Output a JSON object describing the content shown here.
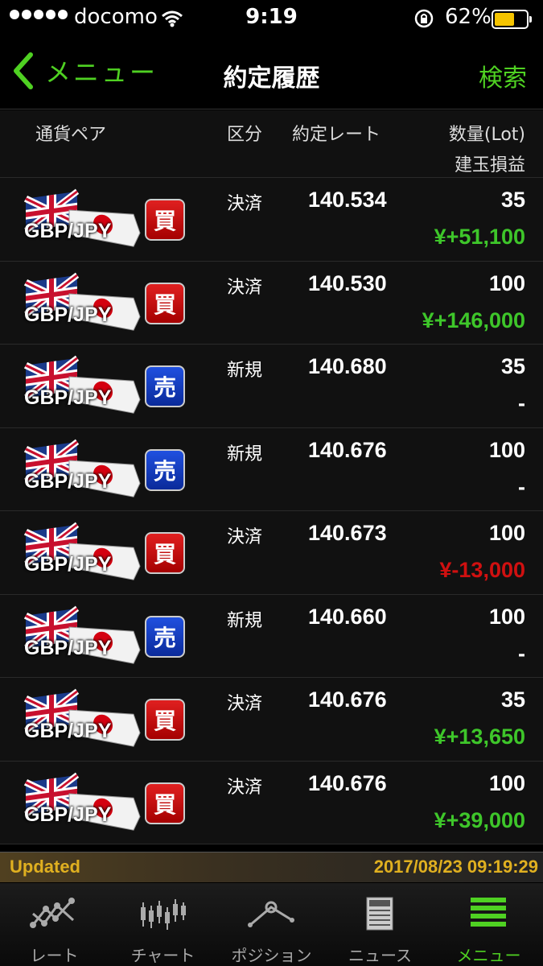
{
  "status_bar": {
    "carrier": "docomo",
    "time": "9:19",
    "battery": "62%",
    "battery_level": 0.62
  },
  "nav": {
    "back_label": "メニュー",
    "title": "約定履歴",
    "search_label": "検索"
  },
  "columns": {
    "pair": "通貨ペア",
    "type": "区分",
    "rate": "約定レート",
    "qty": "数量(Lot)",
    "pl": "建玉損益"
  },
  "rows": [
    {
      "pair": "GBP/JPY",
      "side": "買",
      "side_kind": "buy",
      "type": "決済",
      "rate": "140.534",
      "qty": "35",
      "pl": "¥+51,100",
      "pl_kind": "pos"
    },
    {
      "pair": "GBP/JPY",
      "side": "買",
      "side_kind": "buy",
      "type": "決済",
      "rate": "140.530",
      "qty": "100",
      "pl": "¥+146,000",
      "pl_kind": "pos"
    },
    {
      "pair": "GBP/JPY",
      "side": "売",
      "side_kind": "sell",
      "type": "新規",
      "rate": "140.680",
      "qty": "35",
      "pl": "-",
      "pl_kind": "none"
    },
    {
      "pair": "GBP/JPY",
      "side": "売",
      "side_kind": "sell",
      "type": "新規",
      "rate": "140.676",
      "qty": "100",
      "pl": "-",
      "pl_kind": "none"
    },
    {
      "pair": "GBP/JPY",
      "side": "買",
      "side_kind": "buy",
      "type": "決済",
      "rate": "140.673",
      "qty": "100",
      "pl": "¥-13,000",
      "pl_kind": "neg"
    },
    {
      "pair": "GBP/JPY",
      "side": "売",
      "side_kind": "sell",
      "type": "新規",
      "rate": "140.660",
      "qty": "100",
      "pl": "-",
      "pl_kind": "none"
    },
    {
      "pair": "GBP/JPY",
      "side": "買",
      "side_kind": "buy",
      "type": "決済",
      "rate": "140.676",
      "qty": "35",
      "pl": "¥+13,650",
      "pl_kind": "pos"
    },
    {
      "pair": "GBP/JPY",
      "side": "買",
      "side_kind": "buy",
      "type": "決済",
      "rate": "140.676",
      "qty": "100",
      "pl": "¥+39,000",
      "pl_kind": "pos"
    }
  ],
  "updated": {
    "label": "Updated",
    "timestamp": "2017/08/23 09:19:29"
  },
  "tabs": [
    {
      "label": "レート",
      "icon": "rate-icon",
      "active": false
    },
    {
      "label": "チャート",
      "icon": "chart-icon",
      "active": false
    },
    {
      "label": "ポジション",
      "icon": "position-icon",
      "active": false
    },
    {
      "label": "ニュース",
      "icon": "news-icon",
      "active": false
    },
    {
      "label": "メニュー",
      "icon": "menu-icon",
      "active": true
    }
  ],
  "colors": {
    "accent_green": "#4fd122",
    "profit_green": "#3ec62a",
    "loss_red": "#d01010",
    "buy_red": "#e02020",
    "sell_blue": "#2050e0",
    "updated_gold": "#e0b020"
  }
}
